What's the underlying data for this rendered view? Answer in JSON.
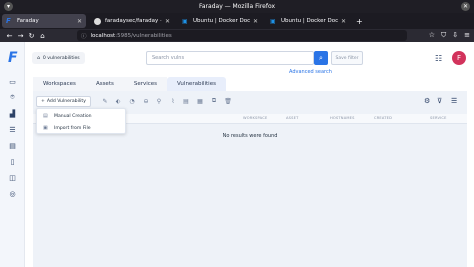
{
  "window": {
    "title": "Faraday — Mozilla Firefox"
  },
  "browser": {
    "tabs": [
      {
        "label": "Faraday",
        "icon": "faraday-icon",
        "active": true
      },
      {
        "label": "faradaysec/faraday · Doc",
        "icon": "github-icon",
        "active": false
      },
      {
        "label": "Ubuntu | Docker Docs",
        "icon": "docker-icon",
        "active": false
      },
      {
        "label": "Ubuntu | Docker Docs",
        "icon": "docker-icon",
        "active": false
      }
    ],
    "url_host": "localhost",
    "url_path": ":5985/vulnerabilities"
  },
  "header": {
    "vuln_count": "0 vulnerabilities",
    "search_placeholder": "Search vulns",
    "save_filter": "Save filter",
    "advanced_search": "Advanced search",
    "avatar_letter": "F"
  },
  "app_tabs": [
    {
      "label": "Workspaces",
      "active": false
    },
    {
      "label": "Assets",
      "active": false
    },
    {
      "label": "Services",
      "active": false
    },
    {
      "label": "Vulnerabilities",
      "active": true
    }
  ],
  "toolbar": {
    "add_label": "Add Vulnerability"
  },
  "add_menu": [
    {
      "label": "Manual Creation",
      "icon": "document-icon"
    },
    {
      "label": "Import from File",
      "icon": "file-import-icon"
    }
  ],
  "table": {
    "columns": [
      "WORKSPACE",
      "ASSET",
      "HOSTNAMES",
      "CREATED",
      "SERVICE"
    ],
    "empty_text": "No results were found"
  },
  "colors": {
    "accent": "#2a74e6",
    "avatar": "#d2335c"
  }
}
